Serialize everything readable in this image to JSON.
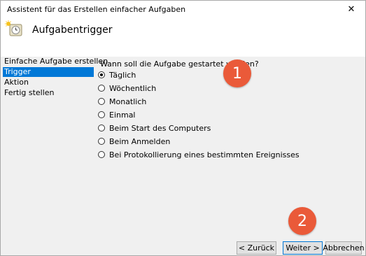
{
  "window": {
    "title": "Assistent für das Erstellen einfacher Aufgaben",
    "close_label": "✕"
  },
  "header": {
    "title": "Aufgabentrigger"
  },
  "sidebar": {
    "items": [
      {
        "label": "Einfache Aufgabe erstellen",
        "active": false
      },
      {
        "label": "Trigger",
        "active": true
      },
      {
        "label": "Aktion",
        "active": false
      },
      {
        "label": "Fertig stellen",
        "active": false
      }
    ]
  },
  "main": {
    "question": "Wann soll die Aufgabe gestartet werden?",
    "options": [
      {
        "label": "Täglich",
        "selected": true
      },
      {
        "label": "Wöchentlich",
        "selected": false
      },
      {
        "label": "Monatlich",
        "selected": false
      },
      {
        "label": "Einmal",
        "selected": false
      },
      {
        "label": "Beim Start des Computers",
        "selected": false
      },
      {
        "label": "Beim Anmelden",
        "selected": false
      },
      {
        "label": "Bei Protokollierung eines bestimmten Ereignisses",
        "selected": false
      }
    ]
  },
  "footer": {
    "back_label": "< Zurück",
    "next_label": "Weiter >",
    "cancel_label": "Abbrechen"
  },
  "annotations": {
    "step1": "1",
    "step2": "2",
    "color": "#ea5a39"
  },
  "icons": {
    "header_icon": "clock-sun-icon",
    "close": "close-icon"
  }
}
